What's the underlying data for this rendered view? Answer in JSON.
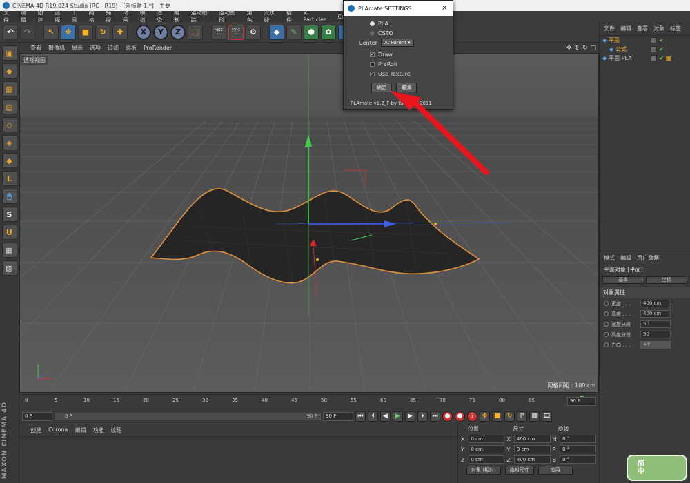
{
  "window": {
    "title": "CINEMA 4D R19.024 Studio (RC - R19) - [未标题 1 *] - 主要"
  },
  "menubar": [
    "文件",
    "编辑",
    "创建",
    "选择",
    "工具",
    "网格",
    "捕捉",
    "动画",
    "模拟",
    "渲染",
    "雕刻",
    "运动跟踪",
    "运动图形",
    "角色",
    "流水线",
    "插件",
    "X-Particles",
    "Co"
  ],
  "viewport": {
    "menu": [
      "查看",
      "摄像机",
      "显示",
      "选项",
      "过滤",
      "面板"
    ],
    "prorender": "ProRender",
    "label": "透视视图",
    "grid_spacing": "网格间距 : 100 cm"
  },
  "dialog": {
    "title": "PLAmate SETTINGS",
    "options": {
      "pla": "PLA",
      "csto": "CSTO"
    },
    "center_label": "Center",
    "center_value": "At Parent",
    "checks": {
      "draw": "Draw",
      "preroll": "PreRoll",
      "use_texture": "Use Texture"
    },
    "ok": "确定",
    "cancel": "取消",
    "footer": "PLAmate v1.2_F by  tudios  ©2011"
  },
  "timeline": {
    "ticks": [
      "0",
      "5",
      "10",
      "15",
      "20",
      "25",
      "30",
      "35",
      "40",
      "45",
      "50",
      "55",
      "60",
      "65",
      "70",
      "75",
      "80",
      "85"
    ],
    "end_frame": "90 F"
  },
  "transport": {
    "start": "0 F",
    "slider_start": "0 F",
    "slider_end": "90 F",
    "end": "90 F"
  },
  "materials": {
    "tabs": [
      "创建",
      "Corona",
      "编辑",
      "功能",
      "纹理"
    ]
  },
  "coords": {
    "headers": [
      "位置",
      "尺寸",
      "旋转"
    ],
    "rows": [
      {
        "a1": "X",
        "v1": "0 cm",
        "a2": "X",
        "v2": "400 cm",
        "a3": "H",
        "v3": "0 °"
      },
      {
        "a1": "Y",
        "v1": "0 cm",
        "a2": "Y",
        "v2": "0 cm",
        "a3": "P",
        "v3": "0 °"
      },
      {
        "a1": "Z",
        "v1": "0 cm",
        "a2": "Z",
        "v2": "400 cm",
        "a3": "B",
        "v3": "0 °"
      }
    ],
    "mode1": "对象 (相对)",
    "mode2": "绝对尺寸",
    "apply": "应用"
  },
  "object_manager": {
    "tabs": [
      "文件",
      "编辑",
      "查看",
      "对象",
      "标签"
    ],
    "items": [
      {
        "name": "平面"
      },
      {
        "name": "公式"
      },
      {
        "name": "平面 PLA"
      }
    ]
  },
  "attributes": {
    "tabs": [
      "模式",
      "编辑",
      "用户数据"
    ],
    "object": "平面对象 [平面]",
    "buttons": [
      "基本",
      "坐标"
    ],
    "section": "对象属性",
    "rows": [
      {
        "label": "宽度 . . .",
        "value": "400 cm"
      },
      {
        "label": "高度 . . .",
        "value": "400 cm"
      },
      {
        "label": "宽度分段",
        "value": "50"
      },
      {
        "label": "高度分段",
        "value": "50"
      },
      {
        "label": "方向 . . .",
        "value": "+Y"
      }
    ]
  },
  "branding": {
    "maxon": "MAXON CINEMA 4D"
  },
  "badge": {
    "text": "简\n中"
  }
}
